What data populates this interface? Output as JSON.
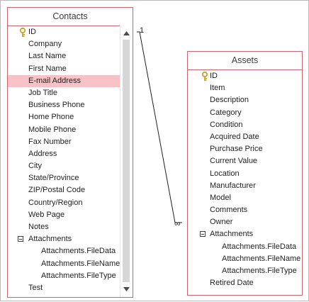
{
  "contacts": {
    "title": "Contacts",
    "fields": [
      {
        "label": "ID",
        "key": true
      },
      {
        "label": "Company"
      },
      {
        "label": "Last Name"
      },
      {
        "label": "First Name"
      },
      {
        "label": "E-mail Address",
        "selected": true
      },
      {
        "label": "Job Title"
      },
      {
        "label": "Business Phone"
      },
      {
        "label": "Home Phone"
      },
      {
        "label": "Mobile Phone"
      },
      {
        "label": "Fax Number"
      },
      {
        "label": "Address"
      },
      {
        "label": "City"
      },
      {
        "label": "State/Province"
      },
      {
        "label": "ZIP/Postal Code"
      },
      {
        "label": "Country/Region"
      },
      {
        "label": "Web Page"
      },
      {
        "label": "Notes"
      },
      {
        "label": "Attachments",
        "collapsible": true
      },
      {
        "label": "Attachments.FileData",
        "sub": true
      },
      {
        "label": "Attachments.FileName",
        "sub": true
      },
      {
        "label": "Attachments.FileType",
        "sub": true
      },
      {
        "label": "Test"
      }
    ]
  },
  "assets": {
    "title": "Assets",
    "fields": [
      {
        "label": "ID",
        "key": true
      },
      {
        "label": "Item"
      },
      {
        "label": "Description"
      },
      {
        "label": "Category"
      },
      {
        "label": "Condition"
      },
      {
        "label": "Acquired Date"
      },
      {
        "label": "Purchase Price"
      },
      {
        "label": "Current Value"
      },
      {
        "label": "Location"
      },
      {
        "label": "Manufacturer"
      },
      {
        "label": "Model"
      },
      {
        "label": "Comments"
      },
      {
        "label": "Owner"
      },
      {
        "label": "Attachments",
        "collapsible": true
      },
      {
        "label": "Attachments.FileData",
        "sub": true
      },
      {
        "label": "Attachments.FileName",
        "sub": true
      },
      {
        "label": "Attachments.FileType",
        "sub": true
      },
      {
        "label": "Retired Date"
      }
    ]
  },
  "relationship": {
    "one_symbol": "1",
    "many_symbol": "∞"
  },
  "colors": {
    "border": "#c8646e",
    "selected_row": "#f6c2c6",
    "key_icon": "#c9a227"
  },
  "icons": {
    "key": "key-icon",
    "collapse": "collapse-minus-icon",
    "scroll_up": "scroll-up-arrow-icon",
    "scroll_down": "scroll-down-arrow-icon"
  }
}
